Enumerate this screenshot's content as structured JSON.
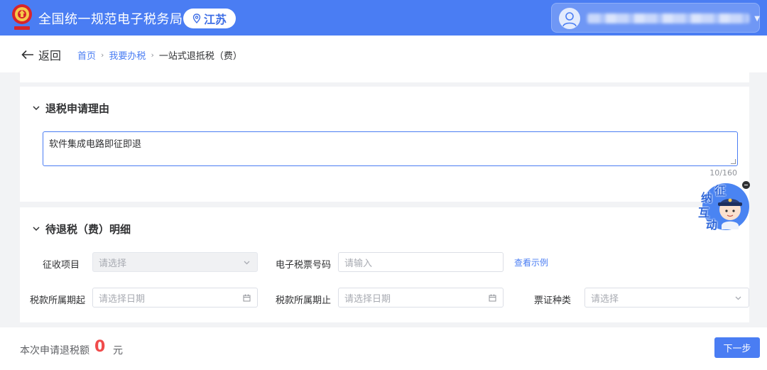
{
  "header": {
    "site_title": "全国统一规范电子税务局",
    "region": "江苏"
  },
  "breadcrumb": {
    "back_label": "返回",
    "items": [
      "首页",
      "我要办税"
    ],
    "current": "一站式退抵税（费）"
  },
  "reason_section": {
    "title": "退税申请理由",
    "reason_value": "软件集成电路即征即退",
    "char_count": "10/160"
  },
  "detail_section": {
    "title": "待退税（费）明细",
    "collection_item": {
      "label": "征收项目",
      "placeholder": "请选择"
    },
    "ticket_number": {
      "label": "电子税票号码",
      "placeholder": "请输入",
      "example_link": "查看示例"
    },
    "period_start": {
      "label": "税款所属期起",
      "placeholder": "请选择日期"
    },
    "period_end": {
      "label": "税款所属期止",
      "placeholder": "请选择日期"
    },
    "voucher_type": {
      "label": "票证种类",
      "placeholder": "请选择"
    }
  },
  "assistant": {
    "chars": [
      "征",
      "纳",
      "互",
      "动"
    ]
  },
  "footer": {
    "label": "本次申请退税额",
    "amount": "0",
    "unit": "元",
    "next_button": "下一步"
  },
  "colors": {
    "primary": "#4a7df3",
    "amount": "#f04b4b"
  }
}
